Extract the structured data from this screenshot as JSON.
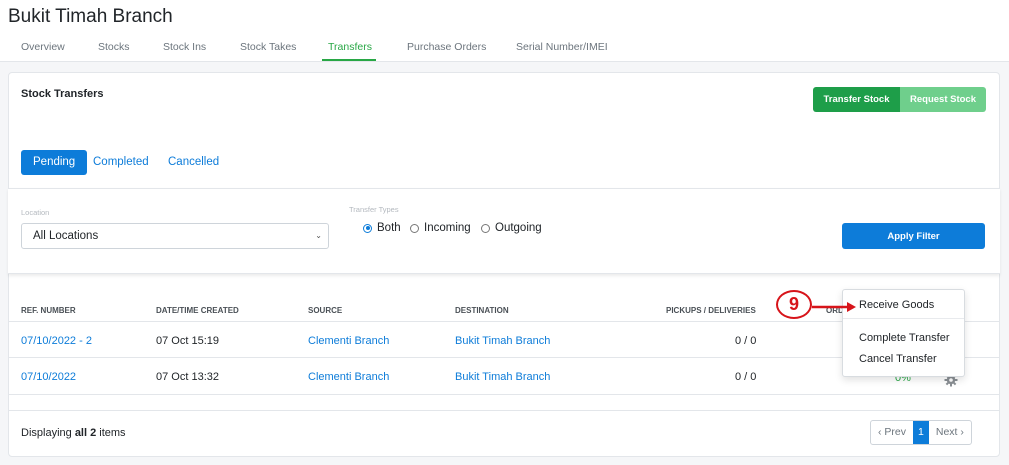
{
  "page": {
    "title": "Bukit Timah Branch"
  },
  "tabs": [
    {
      "label": "Overview"
    },
    {
      "label": "Stocks"
    },
    {
      "label": "Stock Ins"
    },
    {
      "label": "Stock Takes"
    },
    {
      "label": "Transfers",
      "active": true
    },
    {
      "label": "Purchase Orders"
    },
    {
      "label": "Serial Number/IMEI"
    }
  ],
  "card": {
    "title": "Stock Transfers",
    "transfer_stock_label": "Transfer Stock",
    "request_stock_label": "Request Stock"
  },
  "status_tabs": [
    {
      "label": "Pending",
      "active": true
    },
    {
      "label": "Completed"
    },
    {
      "label": "Cancelled"
    }
  ],
  "filters": {
    "location_label": "Location",
    "location_value": "All Locations",
    "transfer_types_label": "Transfer Types",
    "types": [
      {
        "label": "Both",
        "checked": true
      },
      {
        "label": "Incoming"
      },
      {
        "label": "Outgoing"
      }
    ],
    "apply_label": "Apply Filter"
  },
  "table": {
    "headers": [
      "REF. NUMBER",
      "DATE/TIME CREATED",
      "SOURCE",
      "DESTINATION",
      "PICKUPS / DELIVERIES",
      "ORD"
    ],
    "rows": [
      {
        "ref": "07/10/2022 - 2",
        "created": "07 Oct 15:19",
        "source": "Clementi Branch",
        "destination": "Bukit Timah Branch",
        "pickups": "0 / 0",
        "progress": ""
      },
      {
        "ref": "07/10/2022",
        "created": "07 Oct 13:32",
        "source": "Clementi Branch",
        "destination": "Bukit Timah Branch",
        "pickups": "0 / 0",
        "progress": "0%"
      }
    ]
  },
  "footer": {
    "display_prefix": "Displaying ",
    "display_bold": "all 2",
    "display_suffix": " items",
    "prev_label": "‹ Prev",
    "current_page": "1",
    "next_label": "Next ›"
  },
  "dropdown_menu": {
    "items": [
      "Receive Goods",
      "Complete Transfer",
      "Cancel Transfer"
    ]
  },
  "annotation": {
    "number": "9"
  },
  "colors": {
    "primary": "#0d7cd9",
    "success": "#1e9e49",
    "success_light": "#6fcf8c",
    "callout": "#d7141a"
  }
}
